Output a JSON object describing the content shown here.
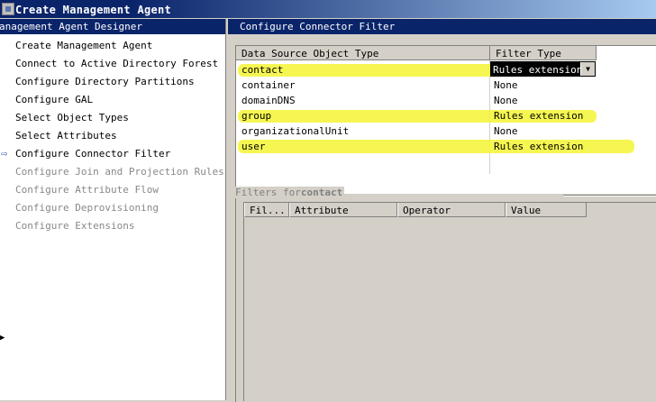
{
  "window": {
    "title": "Create Management Agent"
  },
  "left_panel": {
    "header": "anagement Agent Designer",
    "items": [
      {
        "label": "Create Management Agent",
        "state": "enabled"
      },
      {
        "label": "Connect to Active Directory Forest",
        "state": "enabled"
      },
      {
        "label": "Configure Directory Partitions",
        "state": "enabled"
      },
      {
        "label": "Configure GAL",
        "state": "enabled"
      },
      {
        "label": "Select Object Types",
        "state": "enabled"
      },
      {
        "label": "Select Attributes",
        "state": "enabled"
      },
      {
        "label": "Configure Connector Filter",
        "state": "current"
      },
      {
        "label": "Configure Join and Projection Rules",
        "state": "disabled"
      },
      {
        "label": "Configure Attribute Flow",
        "state": "disabled"
      },
      {
        "label": "Configure Deprovisioning",
        "state": "disabled"
      },
      {
        "label": "Configure Extensions",
        "state": "disabled"
      }
    ]
  },
  "right_panel": {
    "header": "Configure Connector Filter",
    "table": {
      "columns": [
        "Data Source Object Type",
        "Filter Type"
      ],
      "rows": [
        {
          "type": "contact",
          "filter": "Rules extension",
          "highlighted": true,
          "selected": true
        },
        {
          "type": "container",
          "filter": "None",
          "highlighted": false
        },
        {
          "type": "domainDNS",
          "filter": "None",
          "highlighted": false
        },
        {
          "type": "group",
          "filter": "Rules extension",
          "highlighted": true
        },
        {
          "type": "organizationalUnit",
          "filter": "None",
          "highlighted": false
        },
        {
          "type": "user",
          "filter": "Rules extension",
          "highlighted": true
        }
      ],
      "dropdown_arrow": "▼"
    },
    "filters": {
      "title_prefix": "Filters for",
      "title_object": "contact",
      "columns": [
        "Fil...",
        "Attribute",
        "Operator",
        "Value"
      ]
    }
  },
  "colors": {
    "highlight": "#f5f534",
    "title_bar": "#0a246a",
    "selected_text": "#ffffff"
  }
}
